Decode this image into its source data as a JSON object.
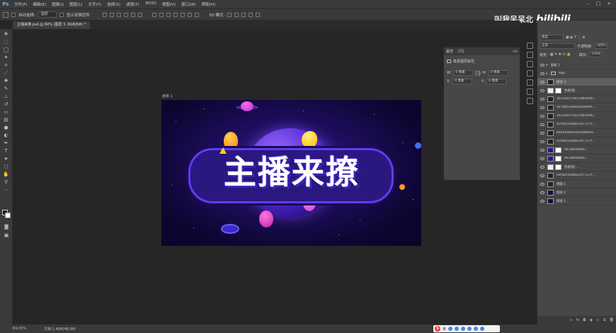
{
  "app": {
    "logo": "Ps"
  },
  "menu": [
    "文件(F)",
    "编辑(E)",
    "图像(I)",
    "图层(L)",
    "文字(Y)",
    "选择(S)",
    "滤镜(T)",
    "3D(D)",
    "视图(V)",
    "窗口(W)",
    "帮助(H)"
  ],
  "options": {
    "auto_select_label": "自动选择:",
    "auto_select_value": "图层",
    "show_transform_label": "显示变换控件",
    "mode_3d_label": "3D 模式:"
  },
  "document": {
    "tab_title": "主播来撩.psd @ 84% (图层 3, RGB/8#) *",
    "artboard_label": "画板 1",
    "title_text": "主播来撩"
  },
  "properties": {
    "tab_active": "属性",
    "tab_inactive": "调整",
    "section_title": "像素图层属性",
    "w_label": "W:",
    "w_value": "0 像素",
    "h_label": "H:",
    "h_value": "0 像素",
    "x_label": "X:",
    "x_value": "0 像素",
    "y_label": "Y:",
    "y_value": "0 像素",
    "go_icon": "GO"
  },
  "layers": {
    "filter_label": "类型",
    "blend_mode": "正常",
    "opacity_label": "不透明度:",
    "opacity_value": "100%",
    "lock_label": "锁定:",
    "fill_label": "填充:",
    "fill_value": "100%",
    "items": [
      {
        "name": "画板 1",
        "kind": "artboard"
      },
      {
        "name": "logo",
        "kind": "group"
      },
      {
        "name": "图层 3",
        "kind": "layer",
        "selected": true
      },
      {
        "name": "色相/饱...",
        "kind": "adjustment"
      },
      {
        "name": "2012da57ea110836d6...",
        "kind": "layer"
      },
      {
        "name": "927db03a64fa3466eff...",
        "kind": "layer"
      },
      {
        "name": "35134a57ea110836d6...",
        "kind": "layer"
      },
      {
        "name": "ecfdd550d8e23f7727f...",
        "kind": "layer"
      },
      {
        "name": "b64fdd9093810e90afd...",
        "kind": "layer"
      },
      {
        "name": "ecfdd550d8e23f7727f...",
        "kind": "layer"
      },
      {
        "name": "4610bfaf98a...",
        "kind": "masked"
      },
      {
        "name": "4610bfaf98a...",
        "kind": "masked"
      },
      {
        "name": "色相/饱...",
        "kind": "adjustment"
      },
      {
        "name": "ecfdd550d8e23f7727f...",
        "kind": "layer"
      },
      {
        "name": "椭圆 1",
        "kind": "shape"
      },
      {
        "name": "图层 2",
        "kind": "layer"
      },
      {
        "name": "图层 1",
        "kind": "layer"
      }
    ],
    "bottom_icons": [
      "link-icon",
      "fx-icon",
      "mask-icon",
      "adjustment-icon",
      "folder-icon",
      "new-layer-icon",
      "trash-icon"
    ]
  },
  "status": {
    "zoom": "84.03%",
    "doc": "文档:1.48M/46.8M"
  },
  "ime": {
    "logo": "S",
    "label": "英"
  },
  "watermark": {
    "text": "叫我呆呆北",
    "logo": "bilibili"
  }
}
